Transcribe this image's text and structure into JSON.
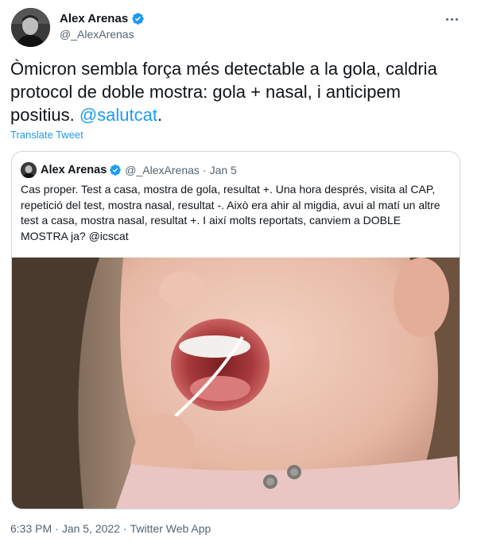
{
  "author": {
    "name": "Alex Arenas",
    "handle": "@_AlexArenas"
  },
  "tweet": {
    "text_before": "Òmicron sembla força més detectable a la gola, caldria protocol de doble mostra: gola + nasal, i anticipem positius. ",
    "mention": "@salutcat",
    "text_after": ".",
    "translate_label": "Translate Tweet"
  },
  "quote": {
    "name": "Alex Arenas",
    "handle": "@_AlexArenas",
    "dot": "·",
    "date": "Jan 5",
    "text": "Cas proper. Test a casa, mostra de gola, resultat +. Una hora després, visita al CAP, repetició del test, mostra nasal, resultat -. Això era ahir al migdia, avui al matí un altre test a casa, mostra nasal, resultat +. I així molts  reportats, canviem a DOBLE MOSTRA ja? @icscat"
  },
  "footer": {
    "time": "6:33 PM",
    "sep1": "·",
    "date": "Jan 5, 2022",
    "sep2": "·",
    "source": "Twitter Web App"
  },
  "icons": {
    "verified": "verified-badge-icon",
    "more": "more-horizontal-icon"
  },
  "colors": {
    "accent": "#1d9bf0",
    "secondary_text": "#536471",
    "border": "#cfd9de"
  }
}
